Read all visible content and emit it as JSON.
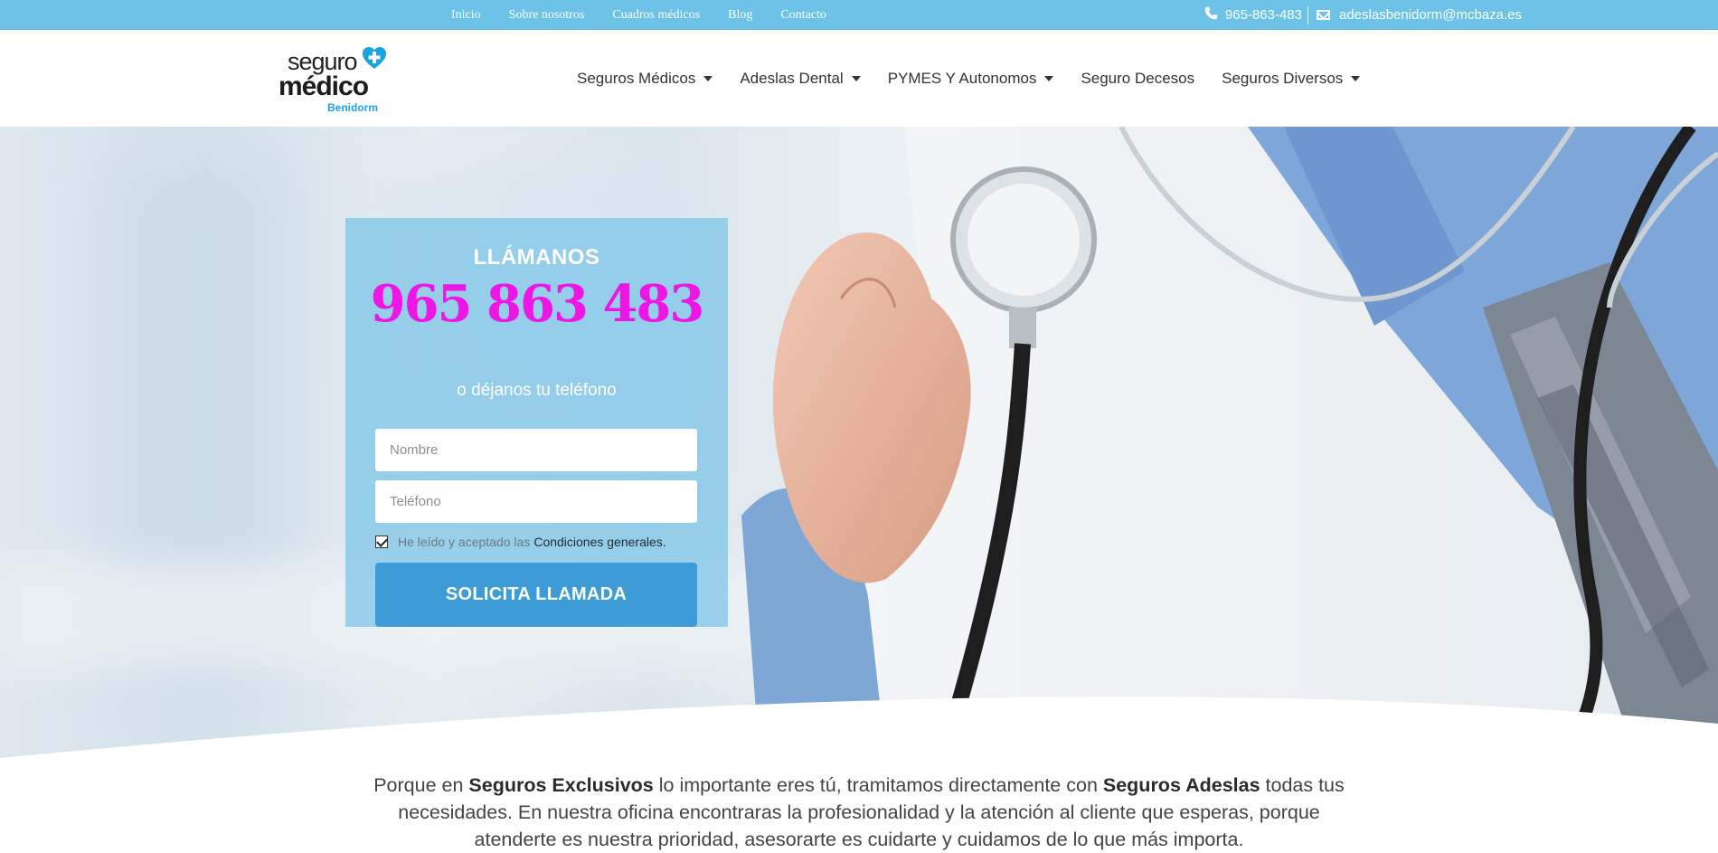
{
  "topbar": {
    "nav": [
      "Inicio",
      "Sobre nosotros",
      "Cuadros médicos",
      "Blog",
      "Contacto"
    ],
    "phone": "965-863-483",
    "email": "adeslasbenidorm@mcbaza.es",
    "phone_icon": "phone-icon",
    "email_icon": "envelope-icon",
    "background": "#6cc3e7"
  },
  "logo": {
    "line1": "seguro",
    "line2": "médico",
    "line3": "Benidorm",
    "accent": "#1aa3e0"
  },
  "mainnav": [
    {
      "label": "Seguros Médicos",
      "dropdown": true
    },
    {
      "label": "Adeslas Dental",
      "dropdown": true
    },
    {
      "label": "PYMES Y Autonomos",
      "dropdown": true
    },
    {
      "label": "Seguro Decesos",
      "dropdown": false
    },
    {
      "label": "Seguros Diversos",
      "dropdown": true
    }
  ],
  "form": {
    "title": "LLÁMANOS",
    "phone": "965 863 483",
    "subtitle": "o déjanos tu teléfono",
    "name_placeholder": "Nombre",
    "phone_placeholder": "Teléfono",
    "consent_text": "He leído y aceptado las",
    "consent_link": "Condiciones generales.",
    "consent_checked": true,
    "submit_label": "SOLICITA LLAMADA",
    "phone_color": "#ee16e4",
    "button_color": "#3d9bd6"
  },
  "intro": {
    "t1": "Porque en ",
    "b1": "Seguros Exclusivos",
    "t2": " lo importante eres tú, tramitamos directamente con ",
    "b2": "Seguros Adeslas",
    "t3": " todas tus necesidades. En  nuestra oficina encontraras la profesionalidad  y la atención al cliente que esperas, porque atenderte es nuestra prioridad, asesorarte es cuidarte y cuidamos de lo que más importa."
  }
}
